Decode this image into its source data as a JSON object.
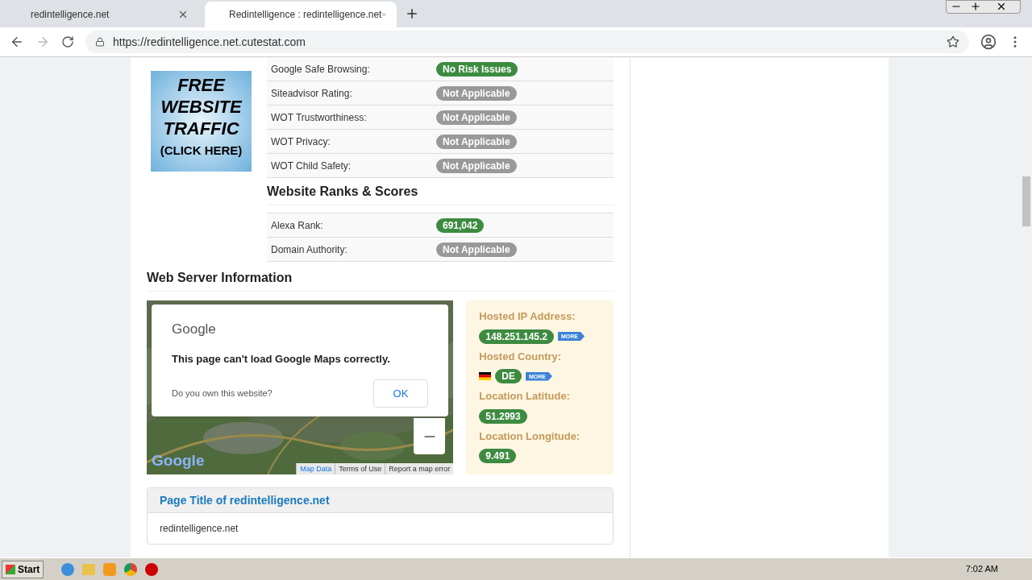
{
  "tabs": [
    {
      "title": "redintelligence.net",
      "selected": false
    },
    {
      "title": "Redintelligence : redintelligence.net",
      "selected": true
    }
  ],
  "address": "https://redintelligence.net.cutestat.com",
  "ad": {
    "lines": [
      "FREE",
      "WEBSITE",
      "TRAFFIC"
    ],
    "cta": "(CLICK HERE)"
  },
  "safety_rows": [
    {
      "label": "Google Safe Browsing:",
      "value": "No Risk Issues",
      "color": "#3d8b40"
    },
    {
      "label": "Siteadvisor Rating:",
      "value": "Not Applicable",
      "color": "#999999"
    },
    {
      "label": "WOT Trustworthiness:",
      "value": "Not Applicable",
      "color": "#999999"
    },
    {
      "label": "WOT Privacy:",
      "value": "Not Applicable",
      "color": "#999999"
    },
    {
      "label": "WOT Child Safety:",
      "value": "Not Applicable",
      "color": "#999999"
    }
  ],
  "ranks": {
    "heading": "Website Ranks & Scores",
    "rows": [
      {
        "label": "Alexa Rank:",
        "value": "691,042",
        "color": "#3d8b40"
      },
      {
        "label": "Domain Authority:",
        "value": "Not Applicable",
        "color": "#999999"
      }
    ]
  },
  "server": {
    "heading": "Web Server Information",
    "map": {
      "kind": "picture",
      "dialog": {
        "brand": "Google",
        "message": "This page can't load Google Maps correctly.",
        "question": "Do you own this website?",
        "button": "OK"
      },
      "logo": "Google",
      "footer": [
        "Map Data",
        "Terms of Use",
        "Report a map error"
      ]
    },
    "info": [
      {
        "label": "Hosted IP Address:",
        "value": "148.251.145.2",
        "more": "MORE"
      },
      {
        "label": "Hosted Country:",
        "value": "DE",
        "more": "MORE",
        "flag": true
      },
      {
        "label": "Location Latitude:",
        "value": "51.2993"
      },
      {
        "label": "Location Longitude:",
        "value": "9.491"
      }
    ]
  },
  "page_title": {
    "heading": "Page Title of redintelligence.net",
    "value": "redintelligence.net"
  },
  "taskbar": {
    "start": "Start",
    "clock": "7:02 AM"
  }
}
